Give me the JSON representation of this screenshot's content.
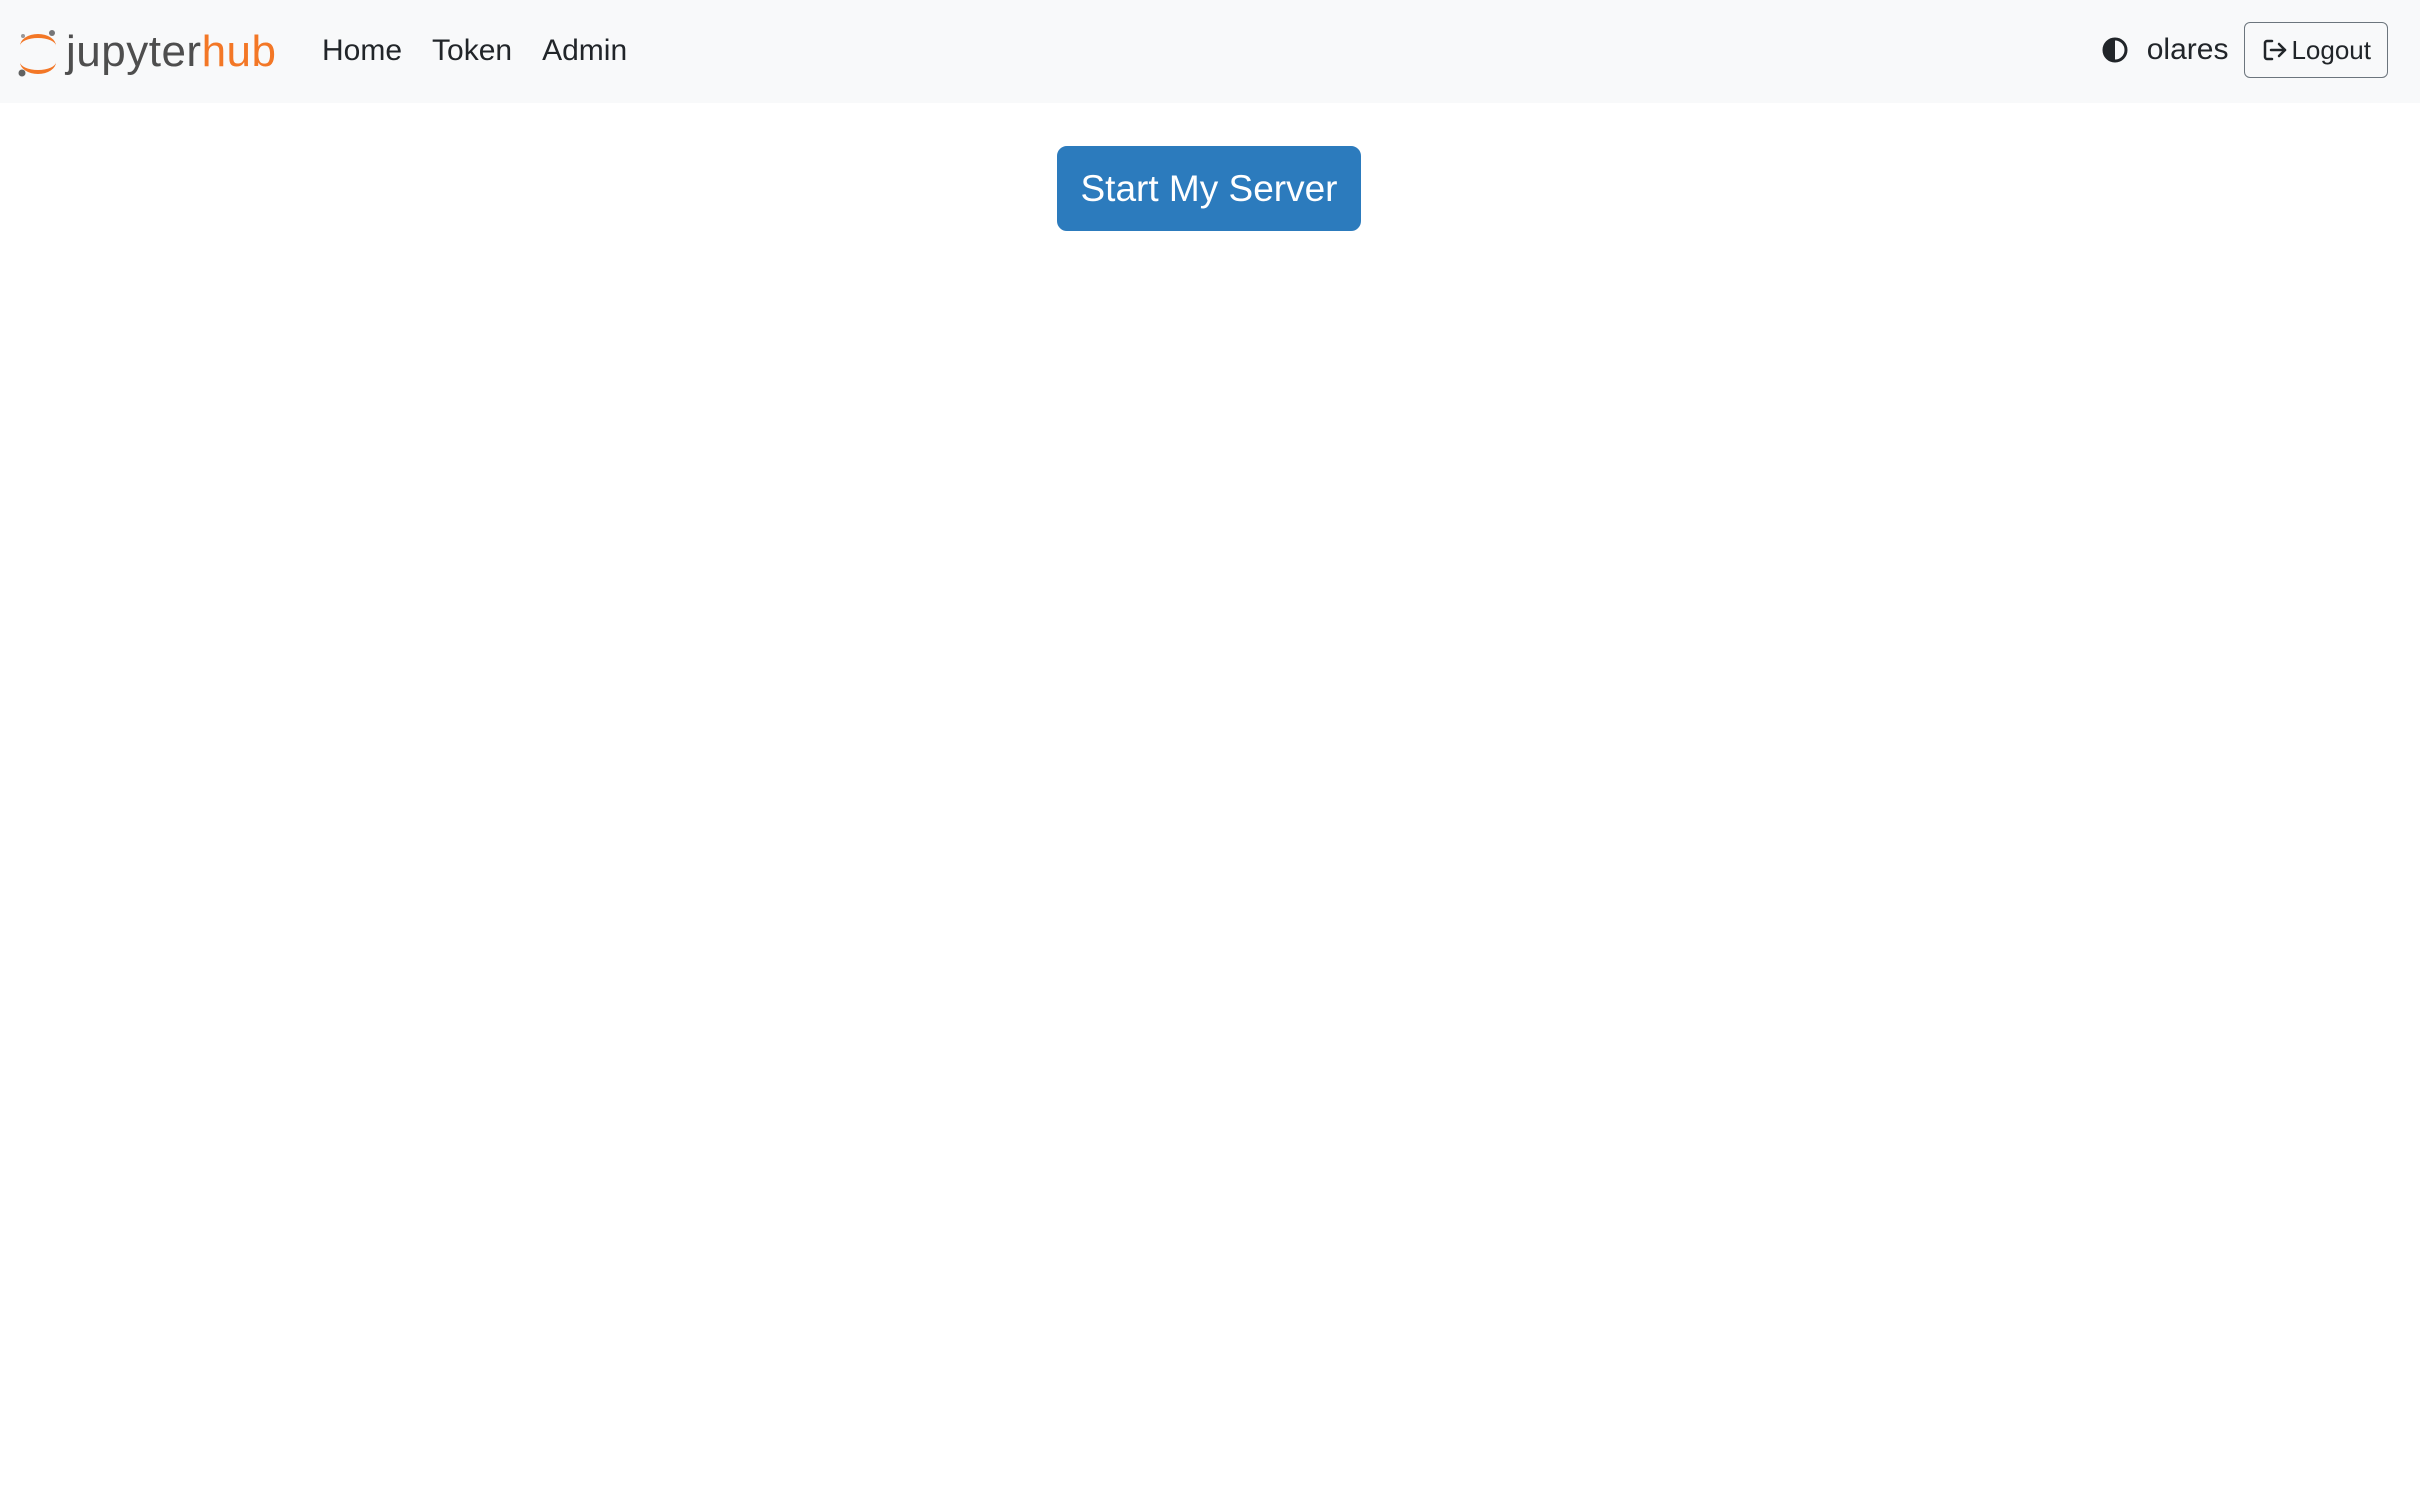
{
  "brand": {
    "name_part1": "jupyter",
    "name_part2": "hub",
    "logo_icon": "jupyter-logo-icon",
    "color_primary": "#f37726",
    "color_text": "#4e4e4e"
  },
  "nav": {
    "items": [
      {
        "label": "Home"
      },
      {
        "label": "Token"
      },
      {
        "label": "Admin"
      }
    ]
  },
  "user": {
    "theme_icon": "half-circle-contrast-icon",
    "username": "olares",
    "logout_label": "Logout",
    "logout_icon": "sign-out-icon"
  },
  "main": {
    "start_button_label": "Start My Server",
    "start_button_color": "#2c7bbd"
  }
}
